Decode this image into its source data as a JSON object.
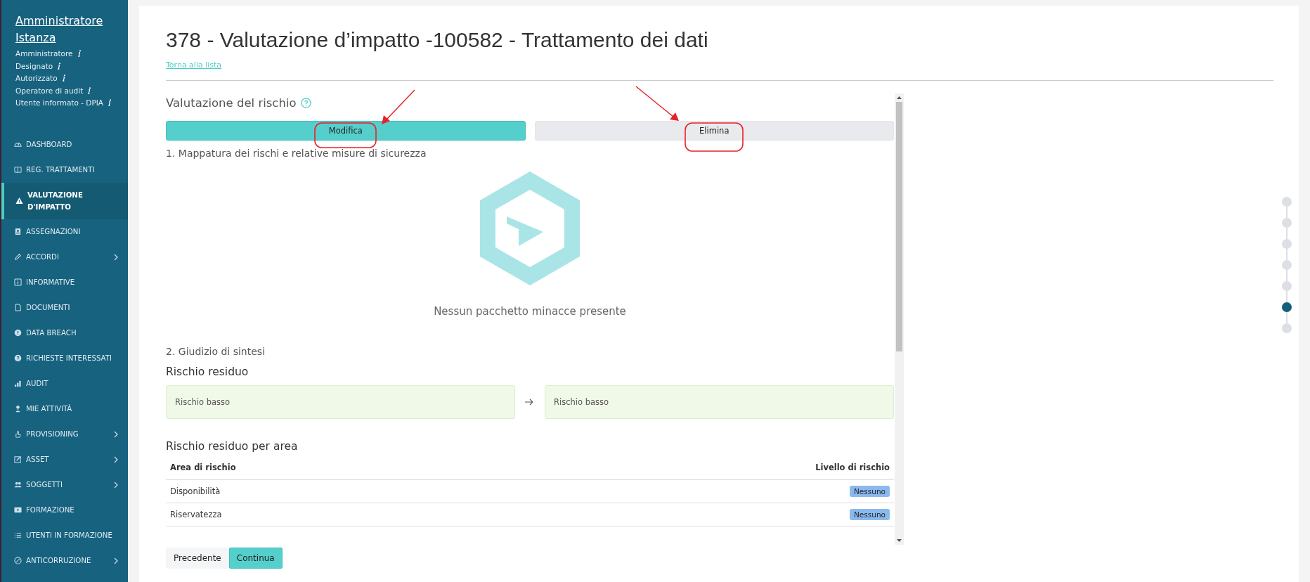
{
  "sidebar": {
    "user": {
      "name": "Amministratore Istanza",
      "roles": [
        "Amministratore",
        "Designato",
        "Autorizzato",
        "Operatore di audit",
        "Utente informato - DPIA"
      ]
    },
    "items": [
      {
        "label": "DASHBOARD",
        "selected": false,
        "expandable": false
      },
      {
        "label": "REG. TRATTAMENTI",
        "selected": false,
        "expandable": false
      },
      {
        "label": "VALUTAZIONE D'IMPATTO",
        "selected": true,
        "expandable": false
      },
      {
        "label": "ASSEGNAZIONI",
        "selected": false,
        "expandable": false
      },
      {
        "label": "ACCORDI",
        "selected": false,
        "expandable": true
      },
      {
        "label": "INFORMATIVE",
        "selected": false,
        "expandable": false
      },
      {
        "label": "DOCUMENTI",
        "selected": false,
        "expandable": false
      },
      {
        "label": "DATA BREACH",
        "selected": false,
        "expandable": false
      },
      {
        "label": "RICHIESTE INTERESSATI",
        "selected": false,
        "expandable": false
      },
      {
        "label": "AUDIT",
        "selected": false,
        "expandable": false
      },
      {
        "label": "MIE ATTIVITÀ",
        "selected": false,
        "expandable": false
      },
      {
        "label": "PROVISIONING",
        "selected": false,
        "expandable": true
      },
      {
        "label": "ASSET",
        "selected": false,
        "expandable": true
      },
      {
        "label": "SOGGETTI",
        "selected": false,
        "expandable": true
      },
      {
        "label": "FORMAZIONE",
        "selected": false,
        "expandable": false
      },
      {
        "label": "UTENTI IN FORMAZIONE",
        "selected": false,
        "expandable": false
      },
      {
        "label": "ANTICORRUZIONE",
        "selected": false,
        "expandable": true
      }
    ]
  },
  "page": {
    "title": "378 - Valutazione d’impatto -100582 - Trattamento dei dati",
    "back_link": "Torna alla lista"
  },
  "section": {
    "title": "Valutazione del rischio",
    "buttons": [
      {
        "label": "Modifica",
        "kind": "primary"
      },
      {
        "label": "Elimina",
        "kind": "secondary"
      }
    ],
    "mapping": {
      "heading": "1. Mappatura dei rischi e relative misure di sicurezza",
      "empty_message": "Nessun pacchetto minacce presente"
    },
    "summary": {
      "heading": "2. Giudizio di sintesi",
      "residual_title": "Rischio residuo",
      "from": "Rischio basso",
      "to": "Rischio basso"
    },
    "area": {
      "title": "Rischio residuo per area",
      "columns": [
        "Area di rischio",
        "Livello di rischio"
      ],
      "rows": [
        {
          "area": "Disponibilità",
          "level": "Nessuno"
        },
        {
          "area": "Riservatezza",
          "level": "Nessuno"
        }
      ]
    }
  },
  "nav_buttons": [
    {
      "label": "Precedente",
      "kind": "secondary"
    },
    {
      "label": "Continua",
      "kind": "primary"
    }
  ],
  "steps": [
    {
      "selected": false
    },
    {
      "selected": false
    },
    {
      "selected": false
    },
    {
      "selected": false
    },
    {
      "selected": false
    },
    {
      "selected": true
    },
    {
      "selected": false
    }
  ]
}
